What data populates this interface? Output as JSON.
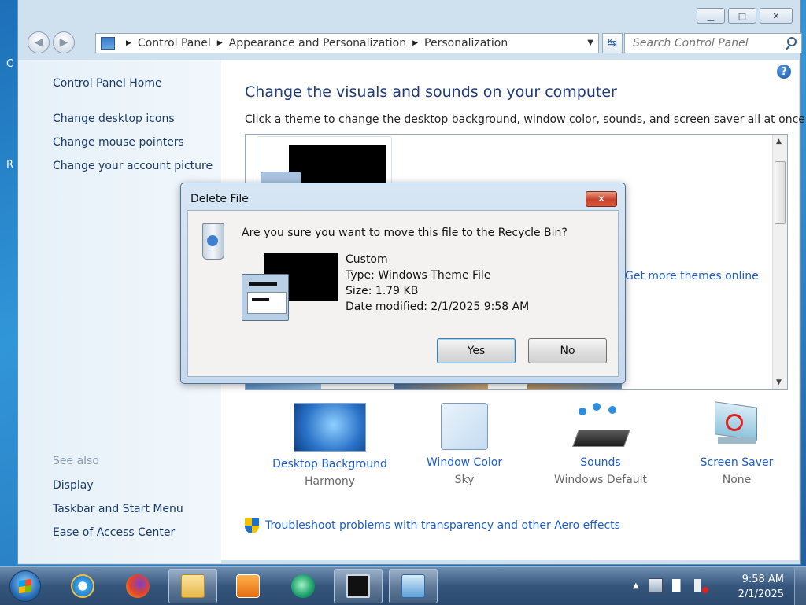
{
  "desktop": {
    "frag1": "C",
    "frag2": "R"
  },
  "window": {
    "min_glyph": "▁",
    "max_glyph": "□",
    "close_glyph": "✕"
  },
  "navbar": {
    "back_glyph": "◀",
    "forward_glyph": "▶",
    "breadcrumbs": [
      "Control Panel",
      "Appearance and Personalization",
      "Personalization"
    ],
    "crumb_separator": "▶",
    "dropdown_glyph": "▼",
    "refresh_glyph": "↹",
    "search_placeholder": "Search Control Panel"
  },
  "left_pane": {
    "home": "Control Panel Home",
    "links": [
      "Change desktop icons",
      "Change mouse pointers",
      "Change your account picture"
    ],
    "see_also": "See also",
    "see_also_links": [
      "Display",
      "Taskbar and Start Menu",
      "Ease of Access Center"
    ]
  },
  "main": {
    "help_glyph": "?",
    "title": "Change the visuals and sounds on your computer",
    "description": "Click a theme to change the desktop background, window color, sounds, and screen saver all at once.",
    "get_more": "Get more themes online",
    "scroll_up": "▲",
    "scroll_down": "▼"
  },
  "tiles": [
    {
      "label": "Desktop Background",
      "sub": "Harmony",
      "icon": "desktop-background-icon"
    },
    {
      "label": "Window Color",
      "sub": "Sky",
      "icon": "window-color-icon"
    },
    {
      "label": "Sounds",
      "sub": "Windows Default",
      "icon": "sounds-icon"
    },
    {
      "label": "Screen Saver",
      "sub": "None",
      "icon": "screen-saver-icon"
    }
  ],
  "troubleshoot": "Troubleshoot problems with transparency and other Aero effects",
  "dialog": {
    "title": "Delete File",
    "close_glyph": "✕",
    "question": "Are you sure you want to move this file to the Recycle Bin?",
    "file_name": "Custom",
    "file_type": "Type: Windows Theme File",
    "file_size": "Size: 1.79 KB",
    "file_modified": "Date modified: 2/1/2025 9:58 AM",
    "yes": "Yes",
    "no": "No"
  },
  "taskbar": {
    "items": [
      "internet-explorer-icon",
      "firefox-icon",
      "file-explorer-icon",
      "media-player-icon",
      "chat-app-icon",
      "command-prompt-icon",
      "control-panel-icon"
    ],
    "time": "9:58 AM",
    "date": "2/1/2025",
    "tray_arrow": "▲"
  },
  "colors": {
    "link": "#1e5ec8",
    "title": "#1e3a7a",
    "window_frame": "#cfe0ef",
    "close_red": "#c9412a"
  }
}
